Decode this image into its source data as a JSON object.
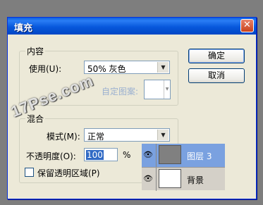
{
  "dialog": {
    "title": "填充",
    "close_glyph": "✕"
  },
  "contents": {
    "legend": "内容",
    "use_label": "使用(U):",
    "use_value": "50% 灰色",
    "custom_pattern_label": "自定图案:"
  },
  "blending": {
    "legend": "混合",
    "mode_label": "模式(M):",
    "mode_value": "正常",
    "opacity_label": "不透明度(O):",
    "opacity_value": "100",
    "opacity_unit": "%",
    "preserve_transparency_label": "保留透明区域(P)"
  },
  "buttons": {
    "ok": "确定",
    "cancel": "取消"
  },
  "layers": [
    {
      "name": "图层 3",
      "selected": true,
      "thumb_color": "#808080"
    },
    {
      "name": "背景",
      "selected": false,
      "thumb_color": "#ffffff"
    }
  ],
  "watermark": "17Pse.com",
  "icons": {
    "dropdown": "chevron-down-icon",
    "visibility": "eye-icon",
    "close": "close-icon"
  },
  "colors": {
    "titlebar": "#0858dc",
    "dialog_bg": "#ece9d8",
    "selection": "#316ac5",
    "layer_selected": "#7aa1e0"
  }
}
